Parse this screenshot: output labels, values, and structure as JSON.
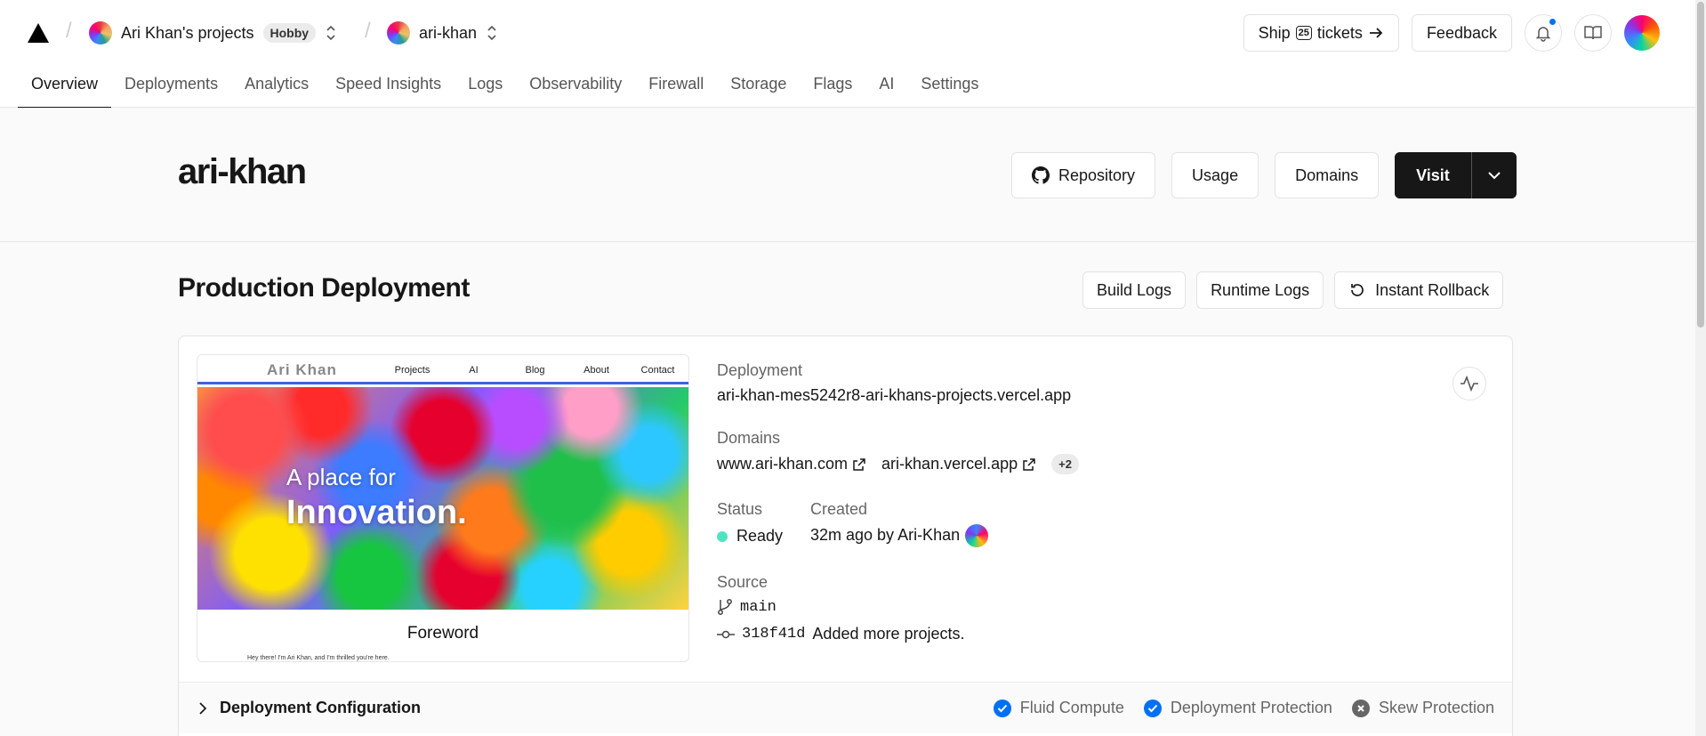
{
  "header": {
    "team_name": "Ari Khan's projects",
    "team_badge": "Hobby",
    "project_name": "ari-khan",
    "ship_label_pre": "Ship",
    "ship_count": "25",
    "ship_label_post": "tickets",
    "feedback_label": "Feedback"
  },
  "tabs": [
    {
      "label": "Overview",
      "active": true
    },
    {
      "label": "Deployments"
    },
    {
      "label": "Analytics"
    },
    {
      "label": "Speed Insights"
    },
    {
      "label": "Logs"
    },
    {
      "label": "Observability"
    },
    {
      "label": "Firewall"
    },
    {
      "label": "Storage"
    },
    {
      "label": "Flags"
    },
    {
      "label": "AI"
    },
    {
      "label": "Settings"
    }
  ],
  "project": {
    "title": "ari-khan",
    "repository_label": "Repository",
    "usage_label": "Usage",
    "domains_label": "Domains",
    "visit_label": "Visit"
  },
  "production": {
    "title": "Production Deployment",
    "build_logs_label": "Build Logs",
    "runtime_logs_label": "Runtime Logs",
    "rollback_label": "Instant Rollback",
    "preview": {
      "logo": "Ari Khan",
      "nav": [
        "Projects",
        "AI",
        "Blog",
        "About",
        "Contact"
      ],
      "hero_line1": "A place for",
      "hero_line2": "Innovation.",
      "heading": "Foreword",
      "paragraph": "Hey there! I'm Ari Khan, and I'm thrilled you're here."
    },
    "deployment_label": "Deployment",
    "deployment_url": "ari-khan-mes5242r8-ari-khans-projects.vercel.app",
    "domains_label": "Domains",
    "domains": [
      "www.ari-khan.com",
      "ari-khan.vercel.app"
    ],
    "domains_more": "+2",
    "status_label": "Status",
    "status_value": "Ready",
    "created_label": "Created",
    "created_value": "32m ago by Ari-Khan",
    "source_label": "Source",
    "branch": "main",
    "commit_hash": "318f41d",
    "commit_message": "Added more projects.",
    "config_label": "Deployment Configuration",
    "config_items": [
      {
        "label": "Fluid Compute",
        "enabled": true
      },
      {
        "label": "Deployment Protection",
        "enabled": true
      },
      {
        "label": "Skew Protection",
        "enabled": false
      }
    ]
  },
  "colors": {
    "accent": "#0070f3",
    "ready": "#50e3c2",
    "primary_button": "#171717"
  }
}
